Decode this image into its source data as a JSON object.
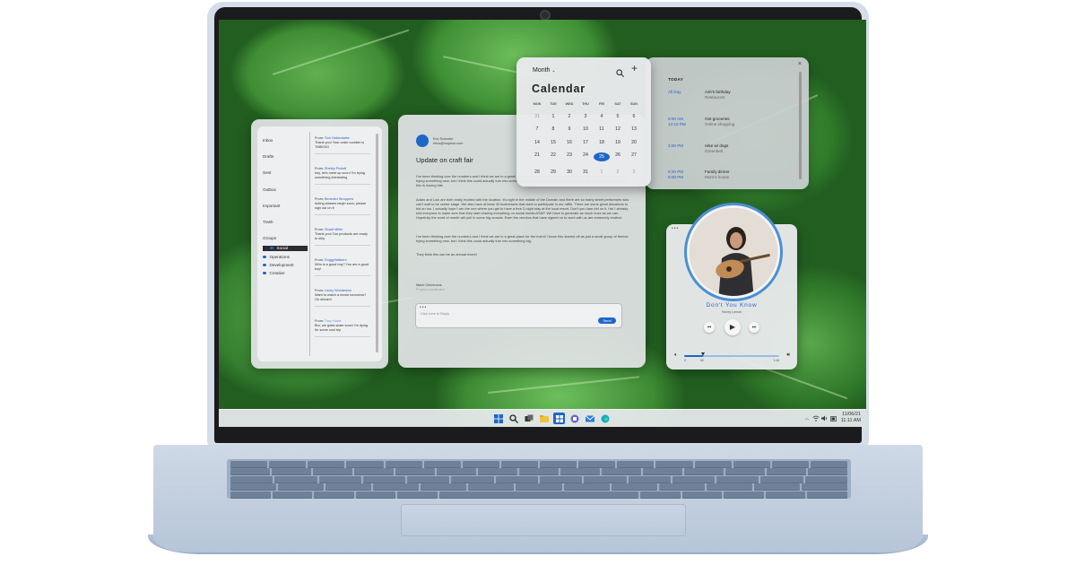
{
  "mail": {
    "folders": [
      "Inbox",
      "Drafts",
      "Sent",
      "Outbox",
      "Important",
      "Trash",
      "Groups"
    ],
    "groups": [
      "Social",
      "Operations",
      "Development",
      "Creative"
    ],
    "messages": [
      {
        "from_label": "From:",
        "from": "Toni Hallandaise",
        "preview": "Thank you! Your order number is TMBO0G"
      },
      {
        "from_label": "From:",
        "from": "Shelby Pickett",
        "preview": "hey, let's meet up soon! I'm trying something interesting"
      },
      {
        "from_label": "From:",
        "from": "Benedict Stroppers",
        "preview": "Acting classes begin soon, please sign out on it"
      },
      {
        "from_label": "From:",
        "from": "Stuart Miller",
        "preview": "Thank you! Our products are ready to ship"
      },
      {
        "from_label": "From:",
        "from": "DoggyWalkers",
        "preview": "Who is a good boy? You are a good boy!"
      },
      {
        "from_label": "From:",
        "from": "Lacey Wunderbar",
        "preview": "Want to watch a movie tomorrow? On stream!"
      },
      {
        "from_label": "From:",
        "from": "Tony Hawk",
        "preview": "Bro, we gotta skate soon! I'm dying for some cool trip"
      }
    ],
    "reader": {
      "sender_name": "Eric Schuster",
      "sender_email": "erics@inspiron.com",
      "subject": "Update on craft fair",
      "paragraphs": [
        "I've been thinking over the numbers and I think we are in a great place for the event! I know this started off as just a small group of friends trying something new, but I think this could actually turn into something big. Just look at all of the excitement around our 98% side project, this is having bite.",
        "Adam and Lulu are both really excited with the location. It's right in the middle of the Domain and there are so many street performers who can't wait to be center stage. We also have at least 30 businesses that want to participate in our raffle. There are some great donations to bid on too. I actually hope I win the one where you get to have a free 2-night stay at the local resort. Don't you dare bid on it. Ha! I already told everyone to make sure that they start sharing everything on social media ASAP. We have to generate as much buzz as we can. Hopefully the word of mouth will pull in some big crowds. Even the vendors that have signed on to work with us are extremely excited.",
        "I've been thinking over the numbers and I think we are in a great place for the event! I know this started off as just a small group of friends trying something new, but I think this could actually turn into something big.",
        "They think this can be an annual event!"
      ],
      "signature_name": "Marie Clemmons",
      "signature_title": "Project coordinator",
      "reply_placeholder": "Click here to Reply",
      "send_label": "Send"
    }
  },
  "calendar": {
    "view_label": "Month",
    "title": "Calendar",
    "weekdays": [
      "MON",
      "TUE",
      "WED",
      "THU",
      "FRI",
      "SAT",
      "SUN"
    ],
    "weeks": [
      [
        "31",
        "1",
        "2",
        "3",
        "4",
        "5",
        "6"
      ],
      [
        "7",
        "8",
        "9",
        "10",
        "11",
        "12",
        "13"
      ],
      [
        "14",
        "15",
        "16",
        "17",
        "18",
        "19",
        "20"
      ],
      [
        "21",
        "22",
        "23",
        "24",
        "25",
        "26",
        "27"
      ],
      [
        "28",
        "29",
        "30",
        "31",
        "1",
        "2",
        "3"
      ]
    ],
    "today": "25",
    "agenda_heading": "TODAY",
    "events": [
      {
        "time": "All Day",
        "title": "Ash's birthday",
        "sub": "Restaurant"
      },
      {
        "time": "9:00 AM",
        "time2": "12:15 PM",
        "title": "Get groceries",
        "sub": "Online shopping"
      },
      {
        "time": "3:00 PM",
        "title": "Hike w/ dogs",
        "sub": "Greenbelt"
      },
      {
        "time": "6:00 PM",
        "time2": "8:00 PM",
        "title": "Family dinner",
        "sub": "Mom's house"
      }
    ]
  },
  "music": {
    "track": "Don't You Know",
    "artist": "Honey Lemon",
    "elapsed": "0",
    "mid": "60",
    "end": "1:45",
    "progress": 0.2
  },
  "taskbar": {
    "date": "11/06/21",
    "time": "11:11 AM"
  },
  "colors": {
    "accent": "#1f66c9",
    "wallpaper": "#2f7b2a",
    "chassis": "#c4d1e1"
  }
}
